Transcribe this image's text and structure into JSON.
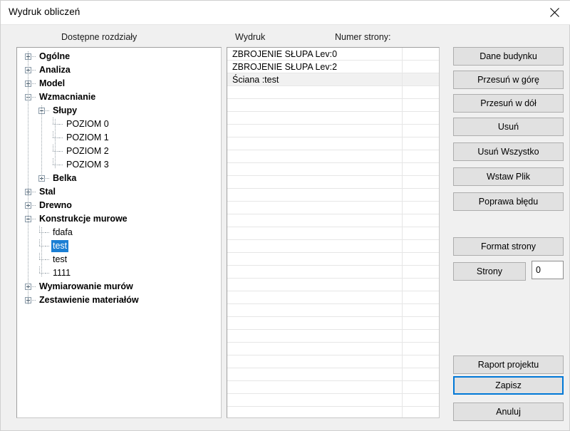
{
  "window": {
    "title": "Wydruk obliczeń",
    "close_icon": "close-icon"
  },
  "headers": {
    "sections": "Dostępne rozdziały",
    "printout": "Wydruk",
    "page_number": "Numer strony:"
  },
  "tree": {
    "selected_label": "test",
    "items": [
      {
        "label": "Ogólne",
        "level": 0,
        "bold": true,
        "expander": "plus",
        "selected": false
      },
      {
        "label": "Analiza",
        "level": 0,
        "bold": true,
        "expander": "plus",
        "selected": false
      },
      {
        "label": "Model",
        "level": 0,
        "bold": true,
        "expander": "plus",
        "selected": false
      },
      {
        "label": "Wzmacnianie",
        "level": 0,
        "bold": true,
        "expander": "minus",
        "selected": false
      },
      {
        "label": "Słupy",
        "level": 1,
        "bold": true,
        "expander": "minus",
        "selected": false
      },
      {
        "label": "POZIOM 0",
        "level": 2,
        "bold": false,
        "expander": "none",
        "selected": false
      },
      {
        "label": "POZIOM 1",
        "level": 2,
        "bold": false,
        "expander": "none",
        "selected": false
      },
      {
        "label": "POZIOM 2",
        "level": 2,
        "bold": false,
        "expander": "none",
        "selected": false
      },
      {
        "label": "POZIOM 3",
        "level": 2,
        "bold": false,
        "expander": "none",
        "selected": false
      },
      {
        "label": "Belka",
        "level": 1,
        "bold": true,
        "expander": "plus",
        "selected": false
      },
      {
        "label": "Stal",
        "level": 0,
        "bold": true,
        "expander": "plus",
        "selected": false
      },
      {
        "label": "Drewno",
        "level": 0,
        "bold": true,
        "expander": "plus",
        "selected": false
      },
      {
        "label": "Konstrukcje murowe",
        "level": 0,
        "bold": true,
        "expander": "minus",
        "selected": false
      },
      {
        "label": "fdafa",
        "level": 1,
        "bold": false,
        "expander": "none",
        "selected": false
      },
      {
        "label": "test",
        "level": 1,
        "bold": false,
        "expander": "none",
        "selected": true
      },
      {
        "label": "test",
        "level": 1,
        "bold": false,
        "expander": "none",
        "selected": false
      },
      {
        "label": "1111",
        "level": 1,
        "bold": false,
        "expander": "none",
        "selected": false
      },
      {
        "label": "Wymiarowanie murów",
        "level": 0,
        "bold": true,
        "expander": "plus",
        "selected": false
      },
      {
        "label": "Zestawienie materiałów",
        "level": 0,
        "bold": true,
        "expander": "plus",
        "selected": false
      }
    ]
  },
  "list": {
    "columns": [
      "Wydruk",
      "Numer strony:"
    ],
    "rows": [
      {
        "name": "ZBROJENIE SŁUPA Lev:0",
        "page": "",
        "shaded": false
      },
      {
        "name": "ZBROJENIE SŁUPA Lev:2",
        "page": "",
        "shaded": false
      },
      {
        "name": "Ściana :test",
        "page": "",
        "shaded": true
      }
    ],
    "empty_rows": 26
  },
  "buttons": {
    "building_data": "Dane budynku",
    "move_up": "Przesuń w górę",
    "move_down": "Przesuń w dół",
    "delete": "Usuń",
    "delete_all": "Usuń Wszystko",
    "insert_file": "Wstaw Plik",
    "fix_error": "Poprawa błędu",
    "page_format": "Format strony",
    "pages": "Strony",
    "pages_value": "0",
    "project_report": "Raport projektu",
    "save": "Zapisz",
    "cancel": "Anuluj"
  },
  "colors": {
    "accent": "#0078d7",
    "selection": "#1b7fd4",
    "dialog_bg": "#f0f0f0",
    "button_bg": "#e1e1e1"
  }
}
